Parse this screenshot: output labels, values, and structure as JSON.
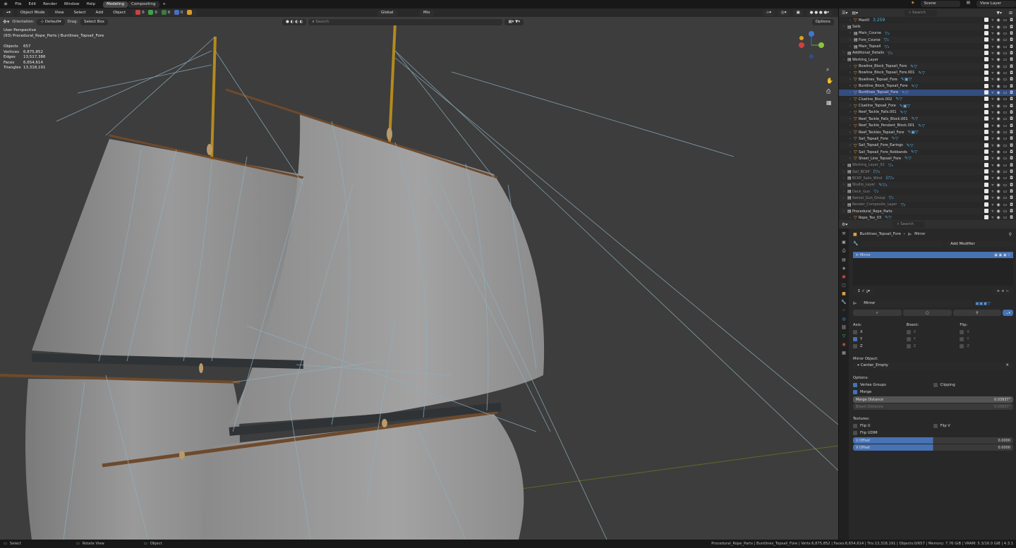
{
  "topbar": {
    "menus": [
      "File",
      "Edit",
      "Render",
      "Window",
      "Help"
    ],
    "workspaces": [
      "Modeling",
      "Compositing"
    ],
    "add_tab": "+",
    "scene": "Scene",
    "view_layer": "View Layer"
  },
  "viewport": {
    "mode": "Object Mode",
    "menus": [
      "View",
      "Select",
      "Add",
      "Object"
    ],
    "counts": [
      "0",
      "0",
      "0",
      "0"
    ],
    "orientation_label": "Orientation:",
    "orientation": "Default",
    "drag_label": "Drag:",
    "drag": "Select Box",
    "transform": "Global",
    "snap": "Mix",
    "search_placeholder": "Search",
    "options": "Options",
    "view_name": "User Perspective",
    "collection_path": "(93) Procedural_Rope_Parts | Buntlines_Topsail_Fore",
    "stats": [
      {
        "k": "Objects",
        "v": "657"
      },
      {
        "k": "Vertices",
        "v": "6,875,852"
      },
      {
        "k": "Edges",
        "v": "13,517,386"
      },
      {
        "k": "Faces",
        "v": "6,654,614"
      },
      {
        "k": "Triangles",
        "v": "13,318,191"
      }
    ],
    "gizmo": {
      "x": "X",
      "y": "Y",
      "z": "Z"
    }
  },
  "outliner": {
    "search_placeholder": "Search",
    "rows": [
      {
        "name": "Mast0",
        "extra": "3.259",
        "indent": 1,
        "icon": "orange",
        "dim": false
      },
      {
        "name": "Sails",
        "indent": 0,
        "icon": "white",
        "dim": false
      },
      {
        "name": "Main_Course",
        "indent": 1,
        "icon": "white",
        "extra": "▽₂",
        "dim": false
      },
      {
        "name": "Fore_Course",
        "indent": 1,
        "icon": "white",
        "extra": "▽₂",
        "dim": false
      },
      {
        "name": "Main_Topsail",
        "indent": 1,
        "icon": "white",
        "extra": "▽₂",
        "dim": false
      },
      {
        "name": "Additional_Details",
        "indent": 0,
        "icon": "white",
        "extra": "▽₅",
        "dim": false
      },
      {
        "name": "Working_Layer",
        "indent": 0,
        "icon": "white",
        "dim": false
      },
      {
        "name": "Bowline_Block_Topsail_Fore",
        "indent": 1,
        "icon": "orange",
        "extra": "✎▽",
        "dim": false
      },
      {
        "name": "Bowline_Block_Topsail_Fore.001",
        "indent": 1,
        "icon": "orange",
        "extra": "✎▽",
        "dim": false
      },
      {
        "name": "Bowlines_Topsail_Fore",
        "indent": 1,
        "icon": "orange",
        "extra": "✎▣▽",
        "dim": false
      },
      {
        "name": "Buntline_Block_Topsail_Fore",
        "indent": 1,
        "icon": "orange",
        "extra": "✎▽",
        "dim": false
      },
      {
        "name": "Buntlines_Topsail_Fore",
        "indent": 1,
        "icon": "orange",
        "extra": "✎▽",
        "dim": false,
        "sel": true
      },
      {
        "name": "Clueline_Block.002",
        "indent": 1,
        "icon": "orange",
        "extra": "✎▽",
        "dim": false
      },
      {
        "name": "Clueline_Topsail_Fore",
        "indent": 1,
        "icon": "orange",
        "extra": "✎▣▽",
        "dim": false
      },
      {
        "name": "Reef_Tackle_Falls.001",
        "indent": 1,
        "icon": "orange",
        "extra": "✎▽",
        "dim": false
      },
      {
        "name": "Reef_Tackle_Falls_Block.001",
        "indent": 1,
        "icon": "orange",
        "extra": "✎▽",
        "dim": false
      },
      {
        "name": "Reef_Tackle_Pendant_Block.001",
        "indent": 1,
        "icon": "orange",
        "extra": "✎▽",
        "dim": false
      },
      {
        "name": "Reef_Tackles_Topsail_Fore",
        "indent": 1,
        "icon": "orange",
        "extra": "✎▣▽",
        "dim": false
      },
      {
        "name": "Sail_Topsail_Fore",
        "indent": 1,
        "icon": "orange",
        "extra": "✎▽",
        "dim": false
      },
      {
        "name": "Sail_Topsail_Fore_Earings",
        "indent": 1,
        "icon": "orange",
        "extra": "✎▽",
        "dim": false
      },
      {
        "name": "Sail_Topsail_Fore_Robbands",
        "indent": 1,
        "icon": "orange",
        "extra": "✎▽",
        "dim": false
      },
      {
        "name": "Sheet_Line_Topsail_Fore",
        "indent": 1,
        "icon": "orange",
        "extra": "✎▽",
        "dim": false
      },
      {
        "name": "Working_Layer_02",
        "indent": 0,
        "icon": "white",
        "extra": "▽₄",
        "dim": true
      },
      {
        "name": "Sail_BCKP",
        "indent": 0,
        "icon": "white",
        "extra": "⟟▽₆",
        "dim": true
      },
      {
        "name": "BCKP_Sails_Wind",
        "indent": 0,
        "icon": "white",
        "extra": "⟟⟟▽₆",
        "dim": true
      },
      {
        "name": "Studio_Layer",
        "indent": 0,
        "icon": "white",
        "extra": "✎▽₄",
        "dim": true
      },
      {
        "name": "Deck_Gun",
        "indent": 0,
        "icon": "white",
        "extra": "▽₂",
        "dim": true
      },
      {
        "name": "Swivel_Gun_Group",
        "indent": 0,
        "icon": "white",
        "extra": "▽₂",
        "dim": true
      },
      {
        "name": "Render_Composite_Layer",
        "indent": 0,
        "icon": "white",
        "extra": "▽₂",
        "dim": true
      },
      {
        "name": "Procedural_Rope_Parts",
        "indent": 0,
        "icon": "white",
        "dim": false
      },
      {
        "name": "Rope_Tex_03",
        "indent": 1,
        "icon": "orange",
        "extra": "✎▽",
        "dim": false
      }
    ]
  },
  "properties": {
    "search_placeholder": "Search",
    "object_name": "Buntlines_Topsail_Fore",
    "modifier_crumb": "Mirror",
    "add_modifier": "Add Modifier",
    "stack_item": "Mirror",
    "modifier_name": "Mirror",
    "axis_header": "Axis:",
    "bisect_header": "Bisect:",
    "flip_header": "Flip:",
    "axes": [
      "X",
      "Y",
      "Z"
    ],
    "mirror_object_label": "Mirror Object:",
    "mirror_object": "Center_Empty",
    "options_label": "Options:",
    "vertex_groups": "Vertex Groups",
    "clipping": "Clipping",
    "merge": "Merge",
    "merge_distance_label": "Merge Distance",
    "merge_distance": "0.03937\"",
    "bisect_distance_label": "Bisect Distance",
    "bisect_distance": "0.03937\"",
    "textures_label": "Textures:",
    "flip_u": "Flip U",
    "flip_v": "Flip V",
    "flip_udim": "Flip UDIM",
    "u_offset_label": "U Offset",
    "u_offset": "0.0000",
    "v_offset_label": "V Offset",
    "v_offset": "0.0000"
  },
  "statusbar": {
    "select": "Select",
    "rotate": "Rotate View",
    "object": "Object",
    "info": "Procedural_Rope_Parts | Buntlines_Topsail_Fore | Verts:6,875,852 | Faces:6,654,614 | Tris:13,318,191 | Objects:0/657 | Memory: 7.76 GiB | VRAM: 5.3/16.0 GiB | 4.3.1"
  },
  "colors": {
    "accent": "#4772b3",
    "selection": "#334d80",
    "sail": "#8b8b8b",
    "rope": "#8fb0c0",
    "spar": "#6e4a2c"
  }
}
